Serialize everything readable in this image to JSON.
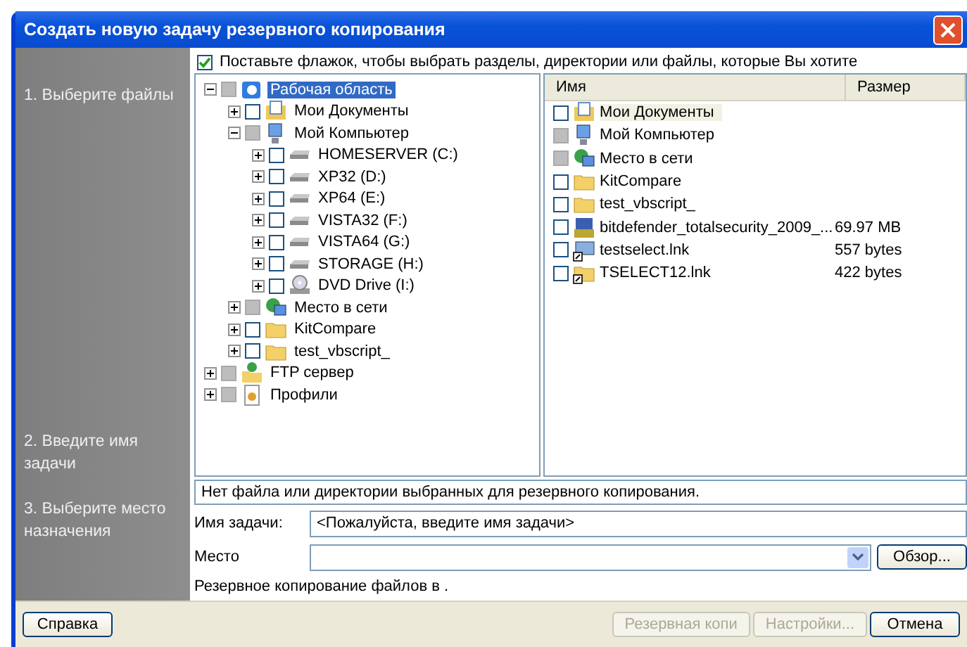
{
  "window": {
    "title": "Создать новую задачу резервного копирования"
  },
  "steps": [
    {
      "label": "1. Выберите файлы"
    },
    {
      "label": "2. Введите имя задачи"
    },
    {
      "label": "3. Выберите место назначения"
    }
  ],
  "select_all": {
    "label": "Поставьте флажок, чтобы выбрать разделы, директории или файлы, которые Вы хотите",
    "checked": true
  },
  "tree": [
    {
      "label": "Рабочая область",
      "kind": "desktop",
      "expanded": true,
      "partial": true,
      "selected": true,
      "children": [
        {
          "label": "Мои Документы",
          "kind": "documents",
          "expanded": false,
          "partial": false,
          "selected": false
        },
        {
          "label": "Мой Компьютер",
          "kind": "computer",
          "expanded": true,
          "partial": true,
          "selected": false,
          "children": [
            {
              "label": "HOMESERVER (C:)",
              "kind": "drive",
              "expanded": false,
              "partial": false,
              "selected": false
            },
            {
              "label": "XP32 (D:)",
              "kind": "drive",
              "expanded": false,
              "partial": false,
              "selected": false
            },
            {
              "label": "XP64 (E:)",
              "kind": "drive",
              "expanded": false,
              "partial": false,
              "selected": false
            },
            {
              "label": "VISTA32 (F:)",
              "kind": "drive",
              "expanded": false,
              "partial": false,
              "selected": false
            },
            {
              "label": "VISTA64 (G:)",
              "kind": "drive",
              "expanded": false,
              "partial": false,
              "selected": false
            },
            {
              "label": "STORAGE (H:)",
              "kind": "drive",
              "expanded": false,
              "partial": false,
              "selected": false
            },
            {
              "label": "DVD Drive (I:)",
              "kind": "dvd",
              "expanded": false,
              "partial": false,
              "selected": false
            }
          ]
        },
        {
          "label": "Место в сети",
          "kind": "network",
          "expanded": false,
          "partial": true,
          "selected": false
        },
        {
          "label": "KitCompare",
          "kind": "folder",
          "expanded": false,
          "partial": false,
          "selected": false
        },
        {
          "label": "test_vbscript_",
          "kind": "folder",
          "expanded": false,
          "partial": false,
          "selected": false
        }
      ]
    },
    {
      "label": "FTP сервер",
      "kind": "ftp",
      "expanded": false,
      "partial": true,
      "selected": false
    },
    {
      "label": "Профили",
      "kind": "profiles",
      "expanded": false,
      "partial": true,
      "selected": false
    }
  ],
  "file_list": {
    "columns": [
      "Имя",
      "Размер"
    ],
    "rows": [
      {
        "name": "Мои Документы",
        "kind": "documents",
        "partial": false,
        "selected": true
      },
      {
        "name": "Мой Компьютер",
        "kind": "computer",
        "partial": true,
        "selected": false
      },
      {
        "name": "Место в сети",
        "kind": "network",
        "partial": true,
        "selected": false
      },
      {
        "name": "KitCompare",
        "kind": "folder",
        "partial": false,
        "selected": false
      },
      {
        "name": "test_vbscript_",
        "kind": "folder",
        "partial": false,
        "selected": false
      },
      {
        "name": "bitdefender_totalsecurity_2009_...",
        "size": "69.97 MB",
        "kind": "installer",
        "partial": false,
        "selected": false
      },
      {
        "name": "testselect.lnk",
        "size": "557 bytes",
        "kind": "shortcut",
        "partial": false,
        "selected": false
      },
      {
        "name": "TSELECT12.lnk",
        "size": "422 bytes",
        "kind": "folder_shortcut",
        "partial": false,
        "selected": false
      }
    ]
  },
  "status": "Нет файла или директории выбранных для резервного копирования.",
  "task_name": {
    "label": "Имя задачи:",
    "value": "<Пожалуйста, введите имя задачи>"
  },
  "destination": {
    "label": "Место",
    "browse": "Обзор..."
  },
  "info": "Резервное копирование файлов в .",
  "help_button": {
    "label": "Справка"
  },
  "buttons": [
    {
      "label": "Резервная копи",
      "disabled": true
    },
    {
      "label": "Настройки...",
      "disabled": true
    },
    {
      "label": "Отмена",
      "disabled": false
    }
  ]
}
